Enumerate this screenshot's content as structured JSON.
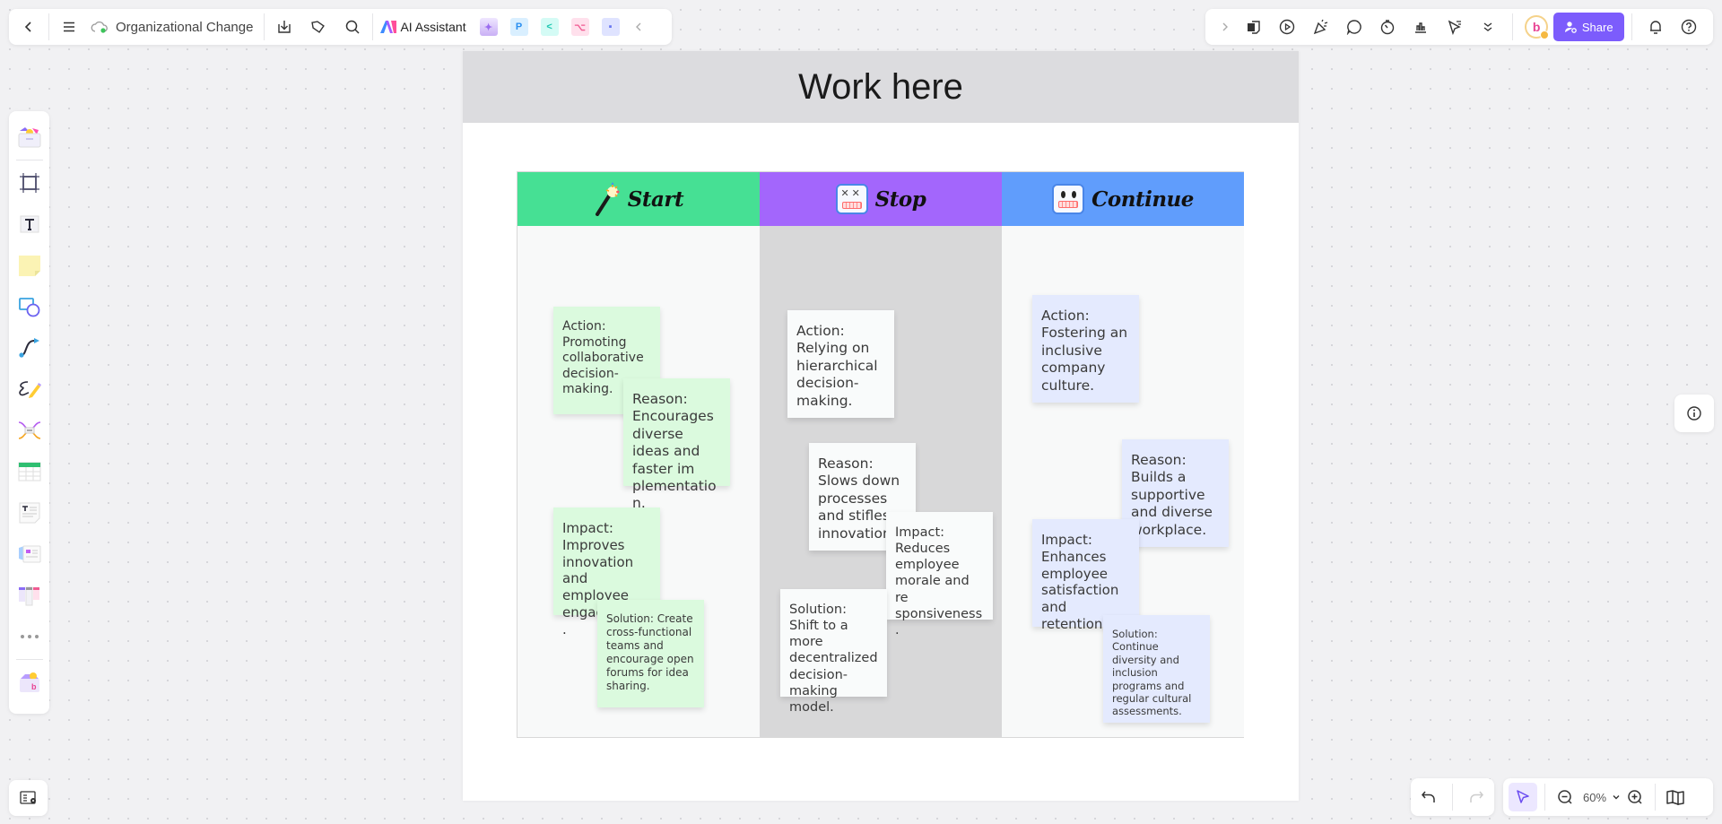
{
  "toolbar_left": {
    "back_label": "‹",
    "menu_label": "☰",
    "doc_title": "Organizational Change",
    "ai_assistant_label": "AI Assistant",
    "apps": [
      {
        "name": "image-gen",
        "glyph": "✦",
        "bg": "#e9ddff",
        "fg": "#9b6cf0"
      },
      {
        "name": "presentation",
        "glyph": "P",
        "bg": "#d9efff",
        "fg": "#2a8ff0"
      },
      {
        "name": "mindmap",
        "glyph": "<",
        "bg": "#d4fbf5",
        "fg": "#1bc7b0"
      },
      {
        "name": "flowchart",
        "glyph": "⌥",
        "bg": "#ffe0ec",
        "fg": "#f05b92"
      },
      {
        "name": "chat",
        "glyph": "▪",
        "bg": "#dfe3ff",
        "fg": "#6876f0"
      }
    ],
    "collapse_label": "‹"
  },
  "toolbar_right": {
    "expand_label": "›",
    "avatar_letter": "b",
    "share_label": "Share"
  },
  "board": {
    "title": "Work here",
    "columns": [
      {
        "label": "Start",
        "color": "#46e094",
        "body_color": "#f8f9f9",
        "notes": [
          {
            "text": "Action: Promoting collaborative decision-making."
          },
          {
            "text": "Reason: Encourages diverse ideas and faster im plementation."
          },
          {
            "text": "Impact: Improves innovation and employee engagement."
          },
          {
            "text": "Solution: Create cross-functional teams and encourage open forums for idea sharing."
          }
        ]
      },
      {
        "label": "Stop",
        "color": "#a366fc",
        "body_color": "#d8d8d9",
        "notes": [
          {
            "text": "Action: Relying on hierarchical decision-making."
          },
          {
            "text": "Reason: Slows down processes and stifles innovation."
          },
          {
            "text": "Impact: Reduces employee morale and re sponsiveness."
          },
          {
            "text": "Solution: Shift to a more decentralized decision-making model."
          }
        ]
      },
      {
        "label": "Continue",
        "color": "#609dfc",
        "body_color": "#f8f9f9",
        "notes": [
          {
            "text": "Action: Fostering an inclusive company culture."
          },
          {
            "text": "Reason: Builds a supportive and diverse workplace."
          },
          {
            "text": "Impact: Enhances employee satisfaction and retention."
          },
          {
            "text": "Solution: Continue diversity and inclusion programs and regular cultural assessments."
          }
        ]
      }
    ]
  },
  "zoom": {
    "level": "60%"
  },
  "colors": {
    "accent": "#7c5cfc",
    "sticky_green": "#dbfade",
    "sticky_white": "#f9fbfb",
    "sticky_blue": "#e4eafe"
  }
}
